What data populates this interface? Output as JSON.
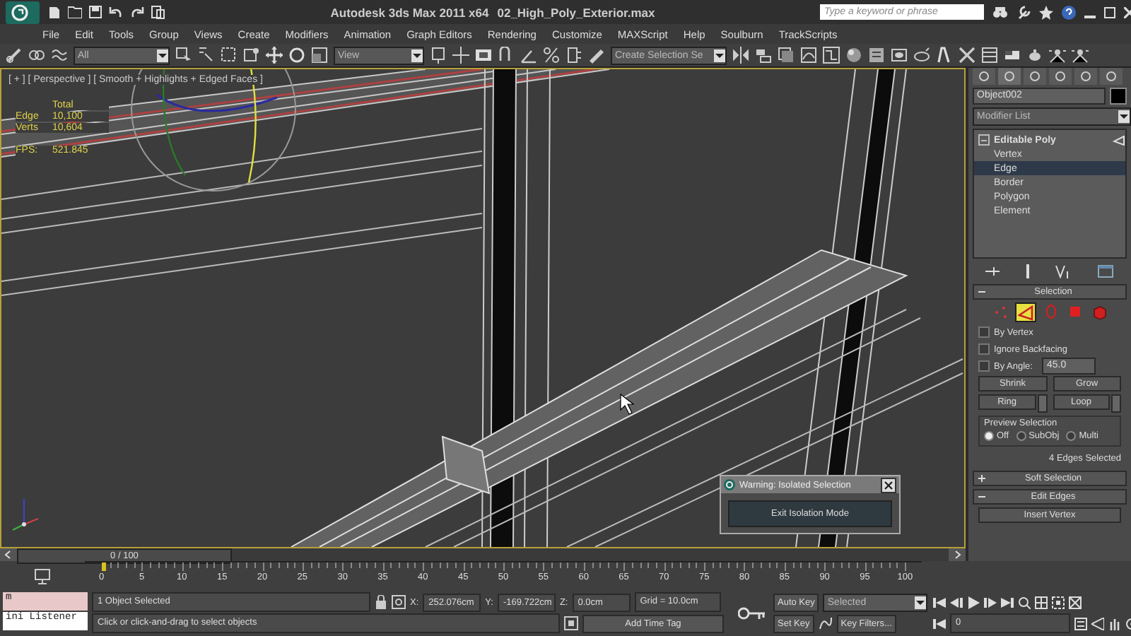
{
  "title_bar": {
    "app_title": "Autodesk 3ds Max  2011 x64",
    "file_name": "02_High_Poly_Exterior.max",
    "search_placeholder": "Type a keyword or phrase"
  },
  "menu": [
    "File",
    "Edit",
    "Tools",
    "Group",
    "Views",
    "Create",
    "Modifiers",
    "Animation",
    "Graph Editors",
    "Rendering",
    "Customize",
    "MAXScript",
    "Help",
    "Soulburn",
    "TrackScripts"
  ],
  "toolbar": {
    "selection_filter": "All",
    "reference_coordinate": "View",
    "named_selection": "Create Selection Se"
  },
  "viewport": {
    "label": "[ + ] [ Perspective ] [ Smooth + Highlights + Edged Faces ]",
    "stats_header": "Total",
    "stats": [
      {
        "label": "Edge",
        "value": "10,100"
      },
      {
        "label": "Verts",
        "value": "10,604"
      }
    ],
    "fps_label": "FPS:",
    "fps_value": "521.845"
  },
  "dialog": {
    "title": "Warning: Isolated Selection",
    "button": "Exit Isolation Mode"
  },
  "command_panel": {
    "object_name": "Object002",
    "modifier_list": "Modifier List",
    "stack": [
      {
        "label": "Editable Poly",
        "expanded": true,
        "selected": false,
        "children": [
          {
            "label": "Vertex",
            "selected": false
          },
          {
            "label": "Edge",
            "selected": true
          },
          {
            "label": "Border",
            "selected": false
          },
          {
            "label": "Polygon",
            "selected": false
          },
          {
            "label": "Element",
            "selected": false
          }
        ]
      }
    ],
    "selection": {
      "title": "Selection",
      "expanded": true,
      "levels": [
        {
          "kind": "vertex",
          "selected": false
        },
        {
          "kind": "edge",
          "selected": true
        },
        {
          "kind": "border",
          "selected": false
        },
        {
          "kind": "polygon",
          "selected": false
        },
        {
          "kind": "element",
          "selected": false
        }
      ],
      "options": [
        {
          "label": "By Vertex",
          "checked": false
        },
        {
          "label": "Ignore Backfacing",
          "checked": false
        },
        {
          "label": "By Angle:",
          "checked": false,
          "value": "45.0"
        }
      ],
      "buttons": [
        {
          "label": "Shrink",
          "spinner": false
        },
        {
          "label": "Grow",
          "spinner": false
        },
        {
          "label": "Ring",
          "spinner": true
        },
        {
          "label": "Loop",
          "spinner": true
        }
      ],
      "preview_title": "Preview Selection",
      "preview": [
        {
          "label": "Off",
          "selected": true
        },
        {
          "label": "SubObj",
          "selected": false
        },
        {
          "label": "Multi",
          "selected": false
        }
      ],
      "count": "4 Edges Selected"
    },
    "rollouts": [
      {
        "title": "Soft Selection",
        "expanded": false
      },
      {
        "title": "Edit Edges",
        "expanded": true
      }
    ],
    "edit_button": "Insert Vertex"
  },
  "time_slider": {
    "label": "0 / 100",
    "level": 0
  },
  "ruler": [
    "0",
    "5",
    "10",
    "15",
    "20",
    "25",
    "30",
    "35",
    "40",
    "45",
    "50",
    "55",
    "60",
    "65",
    "70",
    "75",
    "80",
    "85",
    "90",
    "95",
    "100"
  ],
  "status_bar": {
    "listener_input": "m",
    "listener_label": "ini Listener",
    "selection_info": "1 Object Selected",
    "prompt": "Click or click-and-drag to select objects",
    "coordinates": [
      {
        "axis": "X:",
        "value": "252.076cm"
      },
      {
        "axis": "Y:",
        "value": "-169.722cm"
      },
      {
        "axis": "Z:",
        "value": "0.0cm"
      }
    ],
    "grid": "Grid = 10.0cm",
    "time_tag": "Add Time Tag",
    "auto_key": "Auto Key",
    "set_key": "Set Key",
    "key_set": "Selected",
    "key_filters": "Key Filters...",
    "frame": "0"
  }
}
